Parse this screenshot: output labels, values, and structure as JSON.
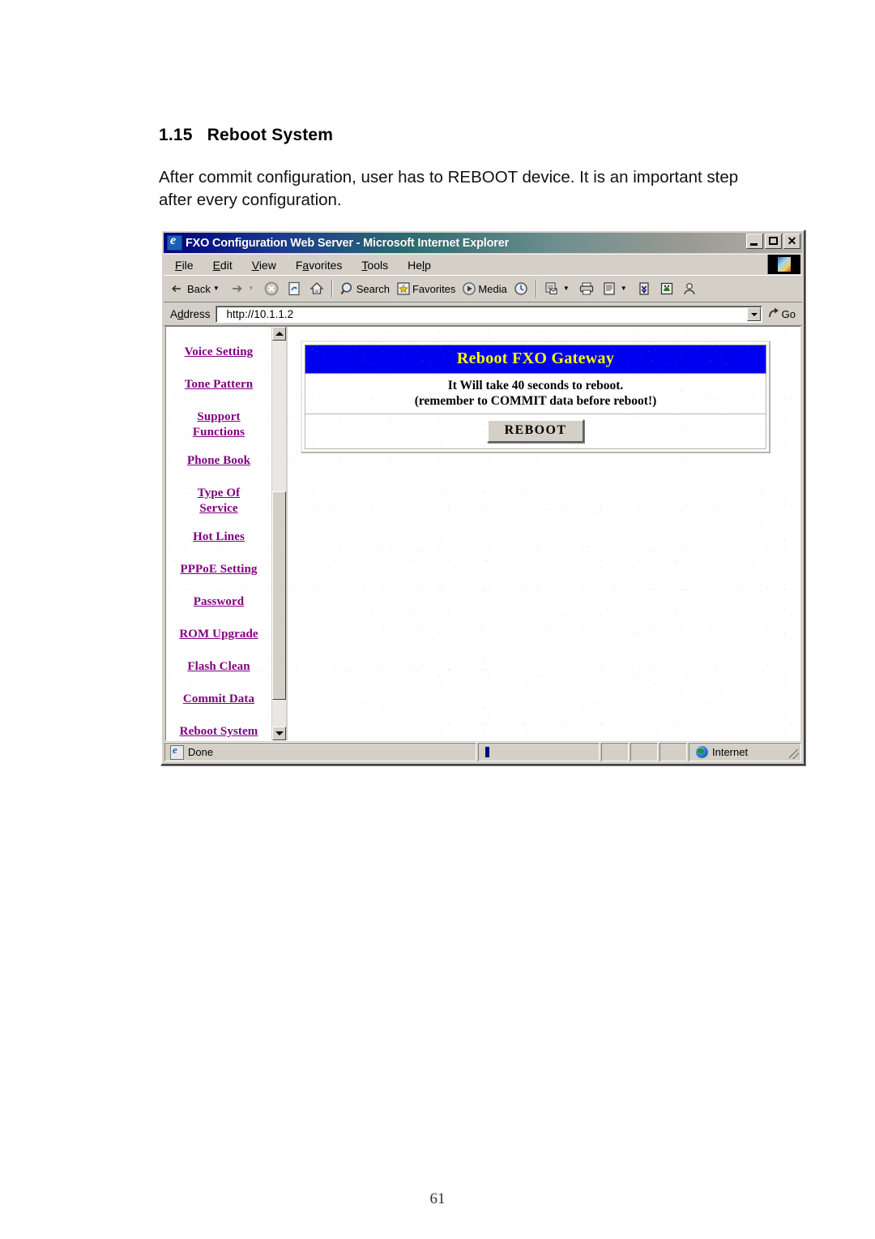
{
  "document": {
    "section_number": "1.15",
    "section_title": "Reboot System",
    "paragraph": "After commit configuration, user has to REBOOT device. It is an important step after every configuration.",
    "page_number": "61"
  },
  "browser": {
    "window_title": "FXO Configuration Web Server - Microsoft Internet Explorer",
    "window_buttons": {
      "minimize": "Minimize",
      "maximize": "Maximize",
      "close": "Close"
    },
    "menu": [
      {
        "label": "File",
        "accel": "F"
      },
      {
        "label": "Edit",
        "accel": "E"
      },
      {
        "label": "View",
        "accel": "V"
      },
      {
        "label": "Favorites",
        "accel": "a"
      },
      {
        "label": "Tools",
        "accel": "T"
      },
      {
        "label": "Help",
        "accel": "H"
      }
    ],
    "toolbar": [
      {
        "name": "back-button",
        "label": "Back",
        "icon": "back-arrow-icon",
        "has_dropdown": true,
        "enabled": true
      },
      {
        "name": "forward-button",
        "label": "",
        "icon": "forward-arrow-icon",
        "has_dropdown": true,
        "enabled": false
      },
      {
        "name": "stop-button",
        "label": "",
        "icon": "stop-icon",
        "enabled": false
      },
      {
        "name": "refresh-button",
        "label": "",
        "icon": "refresh-icon",
        "enabled": true
      },
      {
        "name": "home-button",
        "label": "",
        "icon": "home-icon",
        "enabled": true
      },
      {
        "name": "search-button",
        "label": "Search",
        "icon": "search-icon",
        "enabled": true
      },
      {
        "name": "favorites-button",
        "label": "Favorites",
        "icon": "favorites-star-icon",
        "enabled": true
      },
      {
        "name": "media-button",
        "label": "Media",
        "icon": "media-icon",
        "enabled": true
      },
      {
        "name": "history-button",
        "label": "",
        "icon": "history-clock-icon",
        "enabled": true
      },
      {
        "name": "mail-button",
        "label": "",
        "icon": "mail-icon",
        "has_dropdown": true,
        "enabled": true
      },
      {
        "name": "print-button",
        "label": "",
        "icon": "printer-icon",
        "enabled": true
      },
      {
        "name": "edit-button",
        "label": "",
        "icon": "edit-page-icon",
        "has_dropdown": true,
        "enabled": true
      },
      {
        "name": "discuss-button",
        "label": "",
        "icon": "discuss-icon",
        "enabled": true
      },
      {
        "name": "messenger-button",
        "label": "",
        "icon": "messenger-icon",
        "enabled": true
      },
      {
        "name": "user-button",
        "label": "",
        "icon": "person-icon",
        "enabled": true
      }
    ],
    "address": {
      "label": "Address",
      "value": "http://10.1.1.2",
      "placeholder": "",
      "go_label": "Go"
    },
    "statusbar": {
      "status_text": "Done",
      "zone_text": "Internet"
    }
  },
  "page": {
    "nav_links": [
      {
        "label": "Voice Setting",
        "name": "nav-voice-setting"
      },
      {
        "label": "Tone Pattern",
        "name": "nav-tone-pattern"
      },
      {
        "label": "Support Functions",
        "name": "nav-support-functions",
        "lines": [
          "Support",
          "Functions"
        ]
      },
      {
        "label": "Phone Book",
        "name": "nav-phone-book"
      },
      {
        "label": "Type Of Service",
        "name": "nav-type-of-service",
        "lines": [
          "Type Of",
          "Service"
        ]
      },
      {
        "label": "Hot Lines",
        "name": "nav-hot-lines"
      },
      {
        "label": "PPPoE Setting",
        "name": "nav-pppoe-setting"
      },
      {
        "label": "Password",
        "name": "nav-password"
      },
      {
        "label": "ROM Upgrade",
        "name": "nav-rom-upgrade"
      },
      {
        "label": "Flash Clean",
        "name": "nav-flash-clean"
      },
      {
        "label": "Commit Data",
        "name": "nav-commit-data"
      },
      {
        "label": "Reboot System",
        "name": "nav-reboot-system"
      }
    ],
    "panel": {
      "title": "Reboot FXO Gateway",
      "message_line1": "It Will take 40 seconds to reboot.",
      "message_line2": "(remember to COMMIT data before reboot!)",
      "button_label": "REBOOT"
    },
    "colors": {
      "panel_header_bg": "#0000f0",
      "panel_header_text": "#ffff00",
      "link": "#800080"
    }
  }
}
